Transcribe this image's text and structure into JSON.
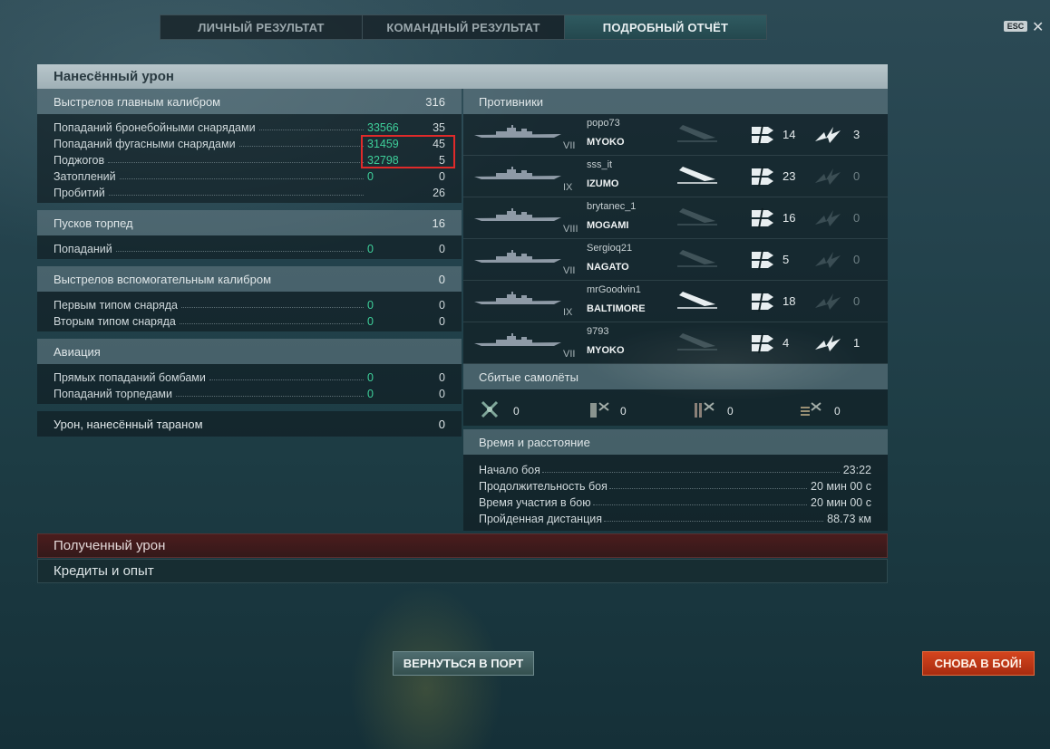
{
  "tabs": [
    {
      "label": "ЛИЧНЫЙ РЕЗУЛЬТАТ",
      "active": false
    },
    {
      "label": "КОМАНДНЫЙ РЕЗУЛЬТАТ",
      "active": false
    },
    {
      "label": "ПОДРОБНЫЙ ОТЧЁТ",
      "active": true
    }
  ],
  "esc_label": "ESC",
  "main_section": {
    "title": "Нанесённый урон"
  },
  "main_caliber": {
    "title": "Выстрелов главным калибром",
    "total": "316",
    "rows": [
      {
        "label": "Попаданий бронебойными снарядами",
        "green": "33566",
        "value": "35"
      },
      {
        "label": "Попаданий фугасными снарядами",
        "green": "31459",
        "value": "45"
      },
      {
        "label": "Поджогов",
        "green": "32798",
        "value": "5"
      },
      {
        "label": "Затоплений",
        "green": "0",
        "value": "0"
      },
      {
        "label": "Пробитий",
        "green": "",
        "value": "26"
      }
    ]
  },
  "torpedoes": {
    "title": "Пусков торпед",
    "total": "16",
    "rows": [
      {
        "label": "Попаданий",
        "green": "0",
        "value": "0"
      }
    ]
  },
  "secondary": {
    "title": "Выстрелов вспомогательным калибром",
    "total": "0",
    "rows": [
      {
        "label": "Первым типом снаряда",
        "green": "0",
        "value": "0"
      },
      {
        "label": "Вторым типом снаряда",
        "green": "0",
        "value": "0"
      }
    ]
  },
  "aviation": {
    "title": "Авиация",
    "rows": [
      {
        "label": "Прямых попаданий бомбами",
        "green": "0",
        "value": "0"
      },
      {
        "label": "Попаданий торпедами",
        "green": "0",
        "value": "0"
      }
    ]
  },
  "ram": {
    "title": "Урон, нанесённый тараном",
    "total": "0"
  },
  "enemies": {
    "title": "Противники",
    "rows": [
      {
        "tier": "VII",
        "player": "popo73",
        "ship": "MYOKO",
        "sunk": false,
        "hits": "14",
        "crits": "3"
      },
      {
        "tier": "IX",
        "player": "sss_it",
        "ship": "IZUMO",
        "sunk": true,
        "hits": "23",
        "crits": "0"
      },
      {
        "tier": "VIII",
        "player": "brytanec_1",
        "ship": "MOGAMI",
        "sunk": false,
        "hits": "16",
        "crits": "0"
      },
      {
        "tier": "VII",
        "player": "Sergioq21",
        "ship": "NAGATO",
        "sunk": false,
        "hits": "5",
        "crits": "0"
      },
      {
        "tier": "IX",
        "player": "mrGoodvin1",
        "ship": "BALTIMORE",
        "sunk": true,
        "hits": "18",
        "crits": "0"
      },
      {
        "tier": "VII",
        "player": "9793",
        "ship": "MYOKO",
        "sunk": false,
        "hits": "4",
        "crits": "1"
      }
    ]
  },
  "planes": {
    "title": "Сбитые самолёты",
    "items": [
      {
        "icon": "fighter-plane-icon",
        "value": "0"
      },
      {
        "icon": "torpedo-bomber-icon",
        "value": "0"
      },
      {
        "icon": "dive-bomber-icon",
        "value": "0"
      },
      {
        "icon": "bomber-squadron-icon",
        "value": "0"
      }
    ]
  },
  "time": {
    "title": "Время и расстояние",
    "rows": [
      {
        "label": "Начало боя",
        "value": "23:22"
      },
      {
        "label": "Продолжительность боя",
        "value": "20 мин 00 с"
      },
      {
        "label": "Время участия в бою",
        "value": "20 мин 00 с"
      },
      {
        "label": "Пройденная дистанция",
        "value": "88.73 км"
      }
    ]
  },
  "received_damage": "Полученный урон",
  "credits_exp": "Кредиты и опыт",
  "buttons": {
    "port": "ВЕРНУТЬСЯ В ПОРТ",
    "battle": "СНОВА В БОЙ!"
  },
  "colors": {
    "accent_green": "#3ecf9a",
    "battle_button": "#c9381a",
    "highlight_box": "#e02a2a"
  }
}
